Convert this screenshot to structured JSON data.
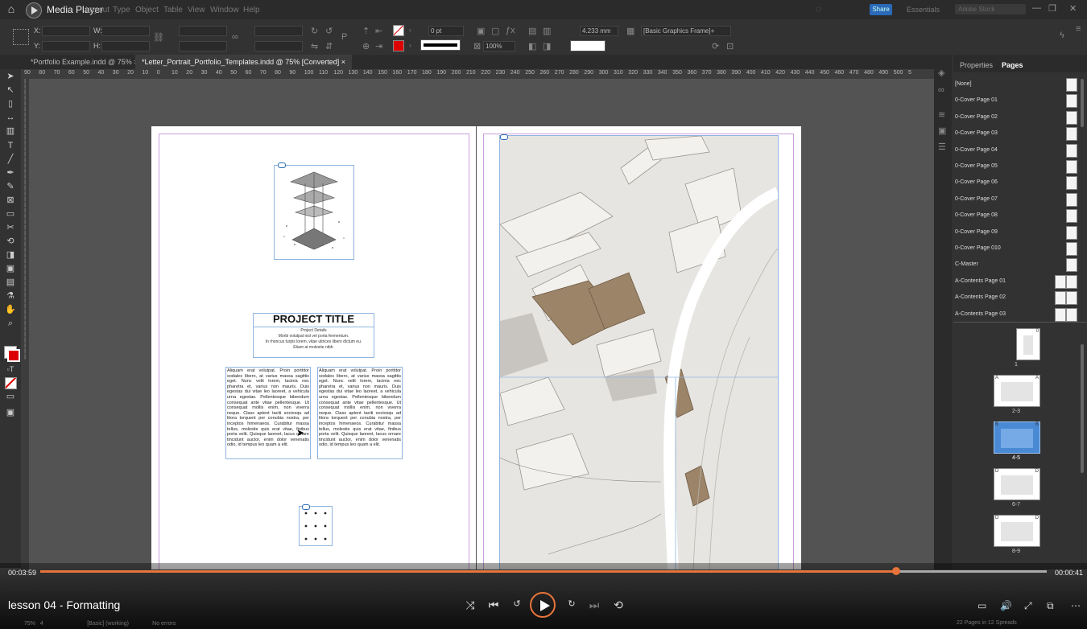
{
  "app": {
    "name": "Media Player"
  },
  "menu": [
    "Layout",
    "Type",
    "Object",
    "Table",
    "View",
    "Window",
    "Help"
  ],
  "topbar": {
    "share": "Share",
    "workspace": "Essentials",
    "search_placeholder": "Adobe Stock"
  },
  "control": {
    "x_label": "X:",
    "y_label": "Y:",
    "w_label": "W:",
    "h_label": "H:",
    "stroke_weight": "0 pt",
    "opacity": "100%",
    "size_field": "4.233 mm",
    "object_style": "[Basic Graphics Frame]+"
  },
  "tabs": [
    {
      "label": "*Portfolio Example.indd @ 75%",
      "close": "×",
      "active": false
    },
    {
      "label": "*Letter_Portrait_Portfolio_Templates.indd @ 75% [Converted]",
      "close": "×",
      "active": true
    }
  ],
  "ruler": [
    "90",
    "80",
    "70",
    "60",
    "50",
    "40",
    "30",
    "20",
    "10",
    "0",
    "10",
    "20",
    "30",
    "40",
    "50",
    "60",
    "70",
    "80",
    "90",
    "100",
    "110",
    "120",
    "130",
    "140",
    "150",
    "160",
    "170",
    "180",
    "190",
    "200",
    "210",
    "220",
    "230",
    "240",
    "250",
    "260",
    "270",
    "280",
    "290",
    "300",
    "310",
    "320",
    "330",
    "340",
    "350",
    "360",
    "370",
    "380",
    "390",
    "400",
    "410",
    "420",
    "430",
    "440",
    "450",
    "460",
    "470",
    "480",
    "490",
    "500",
    "5"
  ],
  "document": {
    "project_title": "PROJECT TITLE",
    "project_details": "Project Details",
    "details_lines": [
      "Morbi volutpat nisl vel porta fermentum.",
      "In rhoncus turpis lorem, vitae ultrices libero dictum eu.",
      "Etiam at molestie nibh."
    ],
    "body_text": "Aliquam erat volutpat. Proin porttitor sodales libero, at varius massa sagittis eget. Nunc velit lorem, lacinia nec pharetra et, varius non mauris. Duis egestas dui vitae leo laoreet, a vehicula urna egestas. Pellentesque bibendum consequat ante vitae pellentesque. Ut consequat mollis enim, non viverra neque. Class aptent taciti sociosqu ad litora torquent per conubia nostra, per inceptos himenaeos. Curabitur massa tellus, molestie quis erat vitae, finibus porta velit. Quisque laoreet, lacus ornare tincidunt auctor, enim dolor venenatis odio, id tempus leo quam a elit."
  },
  "panel": {
    "tabs": [
      "Properties",
      "Pages"
    ],
    "masters": [
      "[None]",
      "0-Cover Page 01",
      "0-Cover Page 02",
      "0-Cover Page 03",
      "0-Cover Page 04",
      "0-Cover Page 05",
      "0-Cover Page 06",
      "0-Cover Page 07",
      "0-Cover Page 08",
      "0-Cover Page 09",
      "0-Cover Page 010",
      "C-Master",
      "A-Contents Page 01",
      "A-Contents Page 02",
      "A-Contents Page 03"
    ],
    "pages": [
      {
        "label": "1",
        "master_left": "",
        "master_right": "0",
        "selected": false
      },
      {
        "label": "2-3",
        "master_left": "A",
        "master_right": "A",
        "selected": false
      },
      {
        "label": "4-5",
        "master_left": "B",
        "master_right": "B",
        "selected": true
      },
      {
        "label": "6-7",
        "master_left": "D",
        "master_right": "D",
        "selected": false
      },
      {
        "label": "8-9",
        "master_left": "D",
        "master_right": "D",
        "selected": false
      }
    ],
    "footer": "22 Pages in 12 Spreads"
  },
  "player": {
    "elapsed": "00:03:59",
    "remaining": "00:00:41",
    "progress": 0.85,
    "lesson_title": "lesson 04 - Formatting"
  },
  "status": {
    "zoom": "75%",
    "page": "4",
    "style": "[Basic] (working)",
    "errors": "No errors"
  }
}
